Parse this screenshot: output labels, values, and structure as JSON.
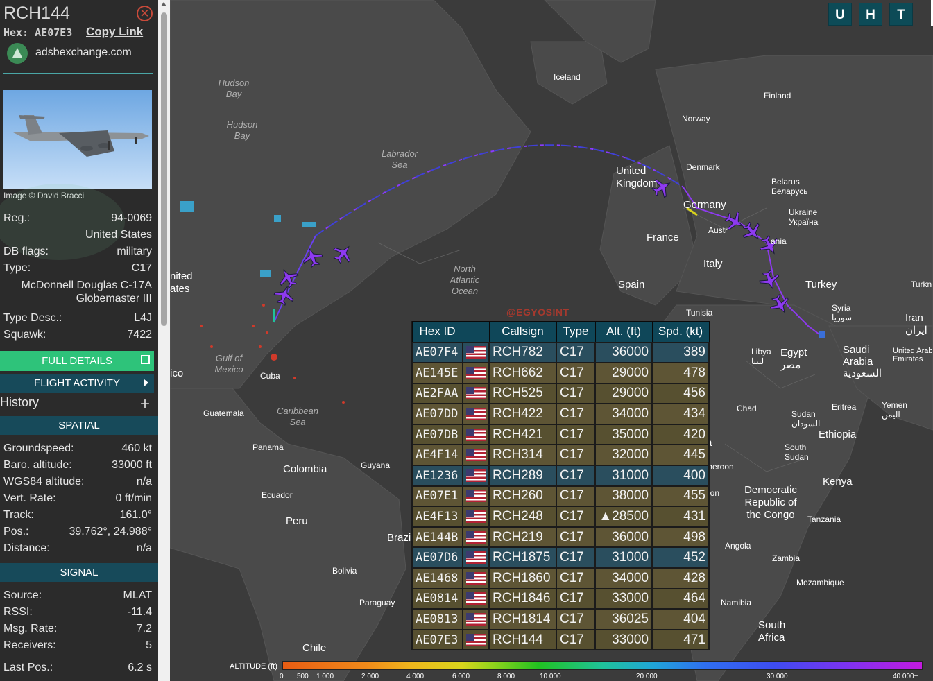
{
  "sidebar": {
    "callsign": "RCH144",
    "hex_label": "Hex:",
    "hex_value": "AE07E3",
    "copy_link": "Copy Link",
    "source_site": "adsbexchange.com",
    "photo_credit": "Image © David Bracci",
    "details": [
      {
        "label": "Reg.:",
        "value": "94-0069"
      },
      {
        "label": "",
        "value": "United States"
      },
      {
        "label": "DB flags:",
        "value": "military"
      },
      {
        "label": "Type:",
        "value": "C17"
      },
      {
        "label": "",
        "value": "McDonnell Douglas C-17A Globemaster III"
      },
      {
        "label": "Type Desc.:",
        "value": "L4J"
      },
      {
        "label": "Squawk:",
        "value": "7422"
      }
    ],
    "full_details": "FULL DETAILS",
    "flight_activity": "FLIGHT ACTIVITY",
    "history": "History",
    "spatial_header": "SPATIAL",
    "spatial": [
      {
        "label": "Groundspeed:",
        "value": "460 kt"
      },
      {
        "label": "Baro. altitude:",
        "value": "33000 ft"
      },
      {
        "label": "WGS84 altitude:",
        "value": "n/a"
      },
      {
        "label": "Vert. Rate:",
        "value": "0 ft/min"
      },
      {
        "label": "Track:",
        "value": "161.0°"
      },
      {
        "label": "Pos.:",
        "value": "39.762°, 24.988°"
      },
      {
        "label": "Distance:",
        "value": "n/a"
      }
    ],
    "signal_header": "SIGNAL",
    "signal": [
      {
        "label": "Source:",
        "value": "MLAT"
      },
      {
        "label": "RSSI:",
        "value": "-11.4"
      },
      {
        "label": "Msg. Rate:",
        "value": "7.2"
      },
      {
        "label": "Receivers:",
        "value": "5"
      }
    ],
    "last_pos": {
      "label": "Last Pos.:",
      "value": "6.2 s"
    }
  },
  "map": {
    "buttons": [
      "U",
      "H",
      "T"
    ],
    "watermark": "@EGYOSINT",
    "labels": {
      "iceland": "Iceland",
      "finland": "Finland",
      "norway": "Norway",
      "denmark": "Denmark",
      "united_kingdom": "United Kingdom",
      "belarus": "Belarus Беларусь",
      "ukraine": "Ukraine Україна",
      "germany": "Germany",
      "france": "France",
      "austria": "Austr",
      "romania": "ania",
      "italy": "Italy",
      "spain": "Spain",
      "turkey": "Turkey",
      "turkey_edge": "Turkn",
      "tunisia": "Tunisia",
      "syria": "Syria سوريا",
      "iran": "Iran ایران",
      "libya": "Libya ليبيا",
      "egypt": "Egypt مصر",
      "saudi": "Saudi Arabia السعودية",
      "uae": "United Arab Emirates",
      "sudan": "Sudan السودان",
      "eritrea": "Eritrea",
      "yemen": "Yemen اليمن",
      "chad": "Chad",
      "south_sudan": "South Sudan",
      "ethiopia": "Ethiopia",
      "kenya": "Kenya",
      "cameroon": "meroon",
      "gabon": "bon",
      "drc": "Democratic Republic of the Congo",
      "tanzania": "Tanzania",
      "angola": "Angola",
      "zambia": "Zambia",
      "mozambique": "Mozambique",
      "namibia": "Namibia",
      "south_africa": "South Africa",
      "hudson1": "Hudson Bay",
      "hudson2": "Hudson Bay",
      "labrador": "Labrador Sea",
      "north_atlantic": "North Atlantic Ocean",
      "united_states": "nited ates",
      "gulf": "Gulf of Mexico",
      "mexico": "ico",
      "cuba": "Cuba",
      "caribbean": "Caribbean Sea",
      "guatemala": "Guatemala",
      "panama": "Panama",
      "colombia": "Colombia",
      "guyana": "Guyana",
      "ecuador": "Ecuador",
      "peru": "Peru",
      "brazil": "Brazi",
      "bolivia": "Bolivia",
      "paraguay": "Paraguay",
      "chile": "Chile",
      "r_edge": "r",
      "a_edge": "a"
    }
  },
  "table": {
    "headers": [
      "Hex ID",
      "",
      "Callsign",
      "Type",
      "Alt. (ft)",
      "Spd. (kt)"
    ],
    "rows": [
      {
        "hex": "AE07F4",
        "callsign": "RCH782",
        "type": "C17",
        "alt": "36000",
        "spd": "389"
      },
      {
        "hex": "AE145E",
        "callsign": "RCH662",
        "type": "C17",
        "alt": "29000",
        "spd": "478"
      },
      {
        "hex": "AE2FAA",
        "callsign": "RCH525",
        "type": "C17",
        "alt": "29000",
        "spd": "456"
      },
      {
        "hex": "AE07DD",
        "callsign": "RCH422",
        "type": "C17",
        "alt": "34000",
        "spd": "434"
      },
      {
        "hex": "AE07DB",
        "callsign": "RCH421",
        "type": "C17",
        "alt": "35000",
        "spd": "420"
      },
      {
        "hex": "AE4F14",
        "callsign": "RCH314",
        "type": "C17",
        "alt": "32000",
        "spd": "445"
      },
      {
        "hex": "AE1236",
        "callsign": "RCH289",
        "type": "C17",
        "alt": "31000",
        "spd": "400"
      },
      {
        "hex": "AE07E1",
        "callsign": "RCH260",
        "type": "C17",
        "alt": "38000",
        "spd": "455"
      },
      {
        "hex": "AE4F13",
        "callsign": "RCH248",
        "type": "C17",
        "alt": "▲28500",
        "spd": "431"
      },
      {
        "hex": "AE144B",
        "callsign": "RCH219",
        "type": "C17",
        "alt": "36000",
        "spd": "498"
      },
      {
        "hex": "AE07D6",
        "callsign": "RCH1875",
        "type": "C17",
        "alt": "31000",
        "spd": "452"
      },
      {
        "hex": "AE1468",
        "callsign": "RCH1860",
        "type": "C17",
        "alt": "34000",
        "spd": "428"
      },
      {
        "hex": "AE0814",
        "callsign": "RCH1846",
        "type": "C17",
        "alt": "33000",
        "spd": "464"
      },
      {
        "hex": "AE0813",
        "callsign": "RCH1814",
        "type": "C17",
        "alt": "36025",
        "spd": "404"
      },
      {
        "hex": "AE07E3",
        "callsign": "RCH144",
        "type": "C17",
        "alt": "33000",
        "spd": "471"
      }
    ]
  },
  "legend": {
    "title": "ALTITUDE (ft)",
    "ticks": [
      "0",
      "500",
      "1 000",
      "2 000",
      "4 000",
      "6 000",
      "8 000",
      "10 000",
      "20 000",
      "30 000",
      "40 000+"
    ]
  }
}
